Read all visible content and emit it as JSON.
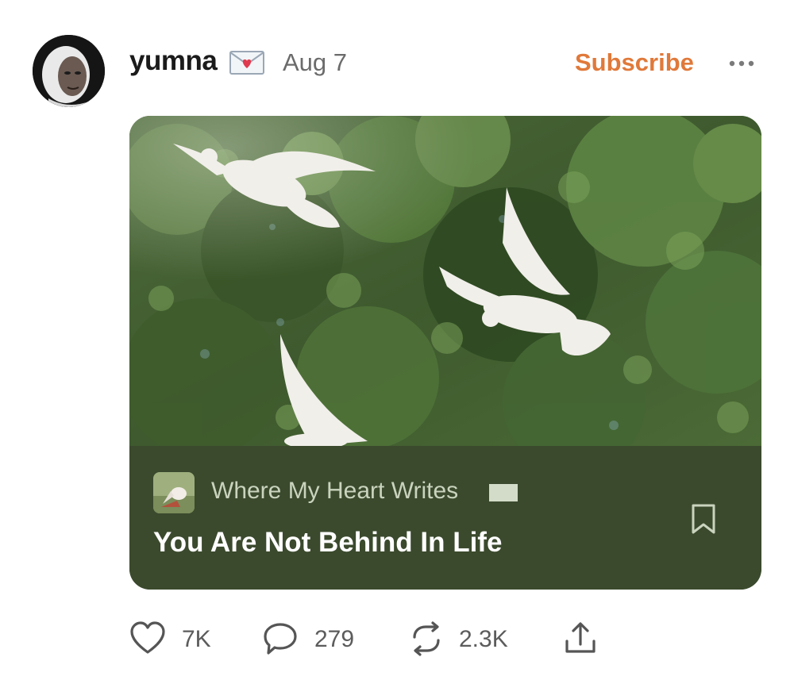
{
  "post": {
    "author": "yumna",
    "author_emoji_icon": "love-letter-icon",
    "date": "Aug 7",
    "subscribe_label": "Subscribe",
    "more_icon": "more-horizontal-icon"
  },
  "card": {
    "image_description_icon": "doves-photo",
    "publication_name": "Where My Heart Writes",
    "title": "You Are Not Behind In Life",
    "bookmark_icon": "bookmark-icon"
  },
  "actions": {
    "likes": "7K",
    "comments": "279",
    "restacks": "2.3K",
    "share_icon": "share-icon"
  },
  "colors": {
    "accent": "#e0793a",
    "card_footer": "#3b4a2d",
    "publication_text": "#c9d3bd",
    "muted": "#6b6b6b"
  }
}
